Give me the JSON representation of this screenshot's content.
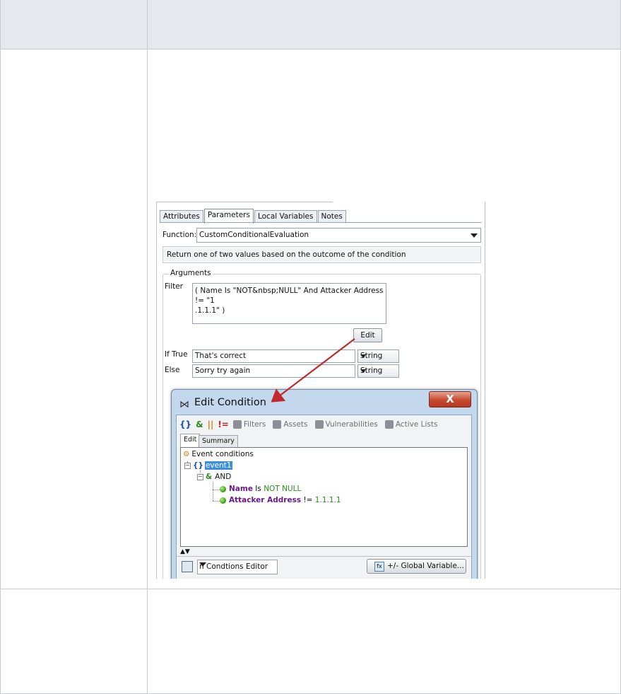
{
  "screenshot": {
    "tabs": [
      "Attributes",
      "Parameters",
      "Local Variables",
      "Notes"
    ],
    "active_tab": "Parameters",
    "function_label": "Function:",
    "function_value": "CustomConditionalEvaluation",
    "description": "Return one of two values based on the outcome of the condition",
    "arguments_title": "Arguments",
    "filter_label": "Filter",
    "filter_line1": "( Name Is \"NOT&nbsp;NULL\" And Attacker Address != \"1",
    "filter_line2": ".1.1.1\" )",
    "edit_button": "Edit",
    "if_true_label": "If True",
    "if_true_value": "That's correct",
    "if_true_type": "String",
    "else_label": "Else",
    "else_value": "Sorry try again",
    "else_type": "String"
  },
  "dialog": {
    "title": "Edit Condition",
    "close_glyph": "X",
    "toolbar": {
      "filters": "Filters",
      "assets": "Assets",
      "vulnerabilities": "Vulnerabilities",
      "active_lists": "Active Lists"
    },
    "tabs": [
      "Edit",
      "Summary"
    ],
    "tree": {
      "root": "Event conditions",
      "event": "event1",
      "operator": "AND",
      "cond1_field": "Name",
      "cond1_op": "Is",
      "cond1_value": "NOT NULL",
      "cond2_field": "Attacker Address",
      "cond2_op": "!=",
      "cond2_value": "1.1.1.1"
    },
    "splitter": "▲▼",
    "mode_value": "n Condtions Editor",
    "global_variable_button": "+/- Global Variable..."
  },
  "colors": {
    "header_bg": "#e5e8ed",
    "arrow": "#c0282e",
    "close_btn": "#c54a2f",
    "keyword": "#6a1a86",
    "value": "#2b8a1a",
    "selection": "#3d8ede"
  }
}
